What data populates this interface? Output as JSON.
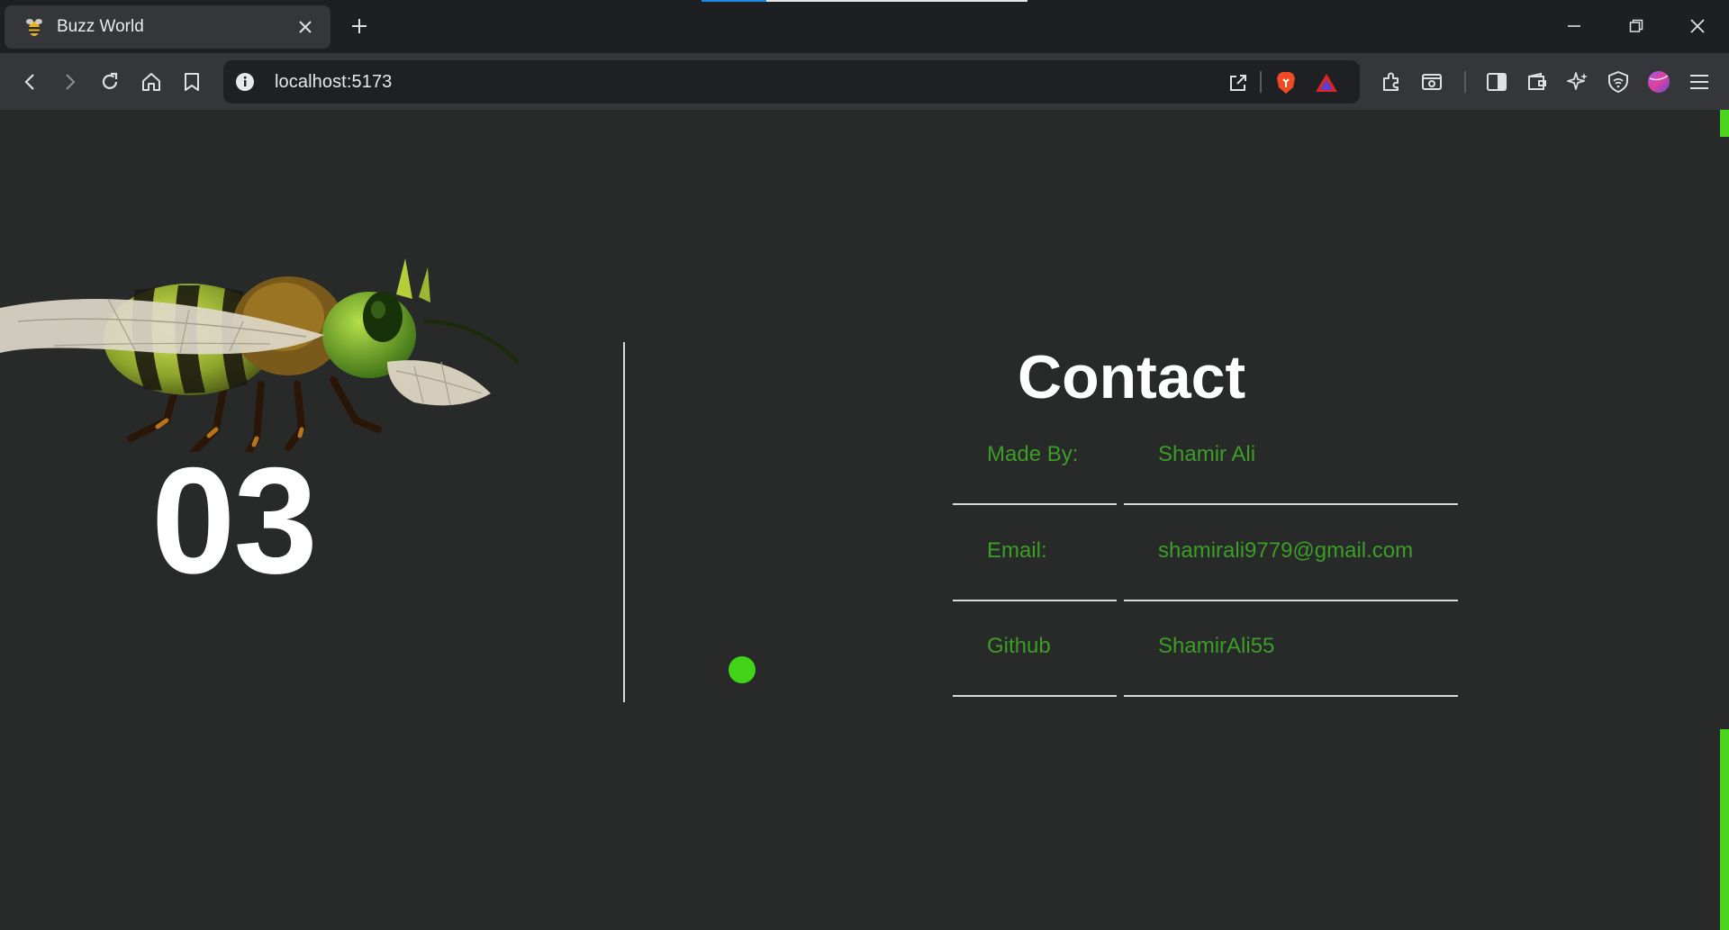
{
  "browser": {
    "load_progress": 0.2,
    "tab": {
      "title": "Buzz World",
      "favicon": "bee-icon"
    },
    "address": {
      "url": "localhost:5173"
    },
    "toolbar_icons": [
      "back-icon",
      "forward-icon",
      "reload-icon",
      "home-icon",
      "bookmark-icon",
      "share-icon",
      "brave-shields-icon",
      "brave-rewards-icon",
      "extensions-icon",
      "screenshot-icon",
      "sidebar-icon",
      "wallet-icon",
      "leo-ai-icon",
      "vpn-icon",
      "profile-icon",
      "menu-icon"
    ]
  },
  "page": {
    "section_number": "03",
    "contact": {
      "title": "Contact",
      "rows": [
        {
          "label": "Made By:",
          "value": "Shamir Ali"
        },
        {
          "label": "Email:",
          "value": "shamirali9779@gmail.com"
        },
        {
          "label": "Github",
          "value": "ShamirAli55"
        }
      ]
    }
  },
  "colors": {
    "page_bg": "#272a29",
    "accent_green": "#43d41a",
    "contact_text_green": "#3c9d27",
    "scroll_accent": "#4bd31e"
  }
}
